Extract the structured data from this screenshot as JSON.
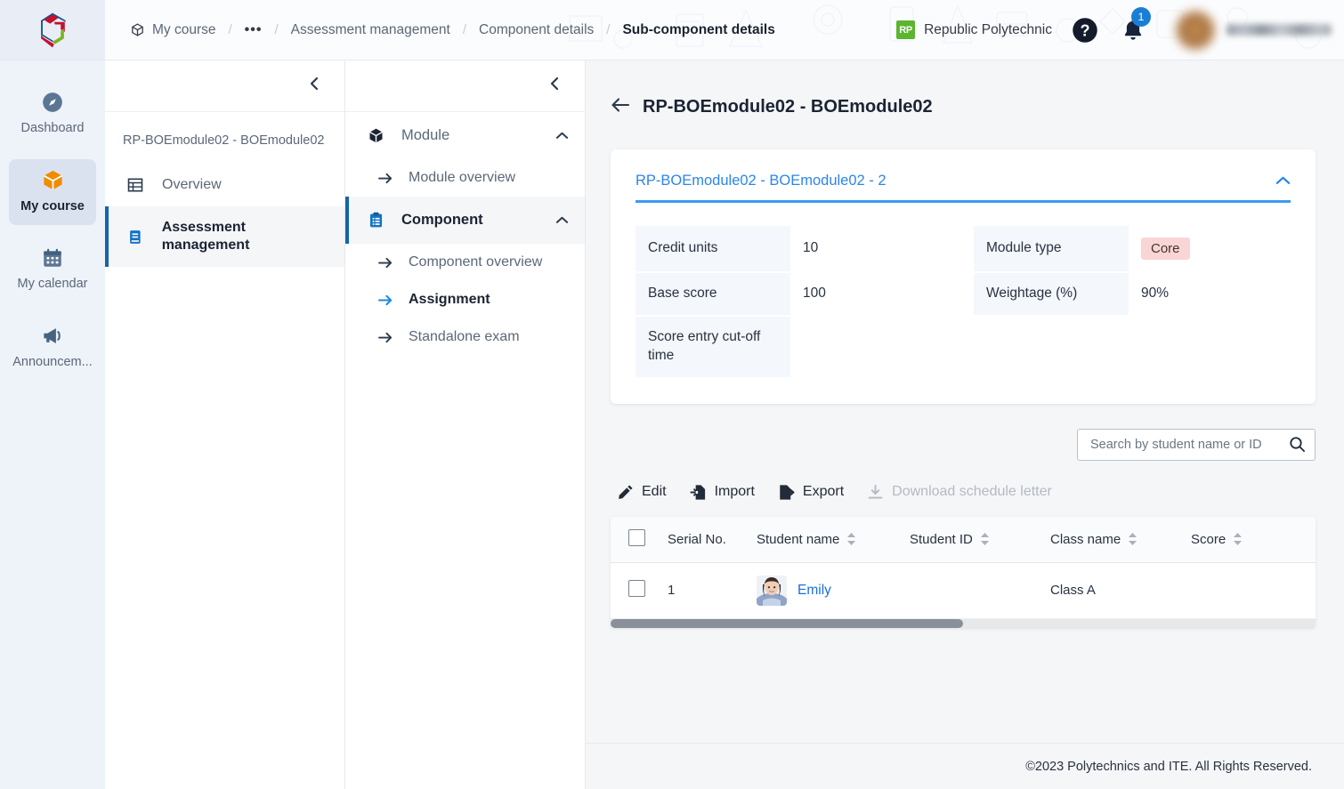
{
  "header": {
    "breadcrumb": [
      {
        "label": "My course",
        "icon": "cube-icon",
        "active": false
      },
      {
        "label": "•••",
        "icon": "ellipsis-icon",
        "active": false
      },
      {
        "label": "Assessment management",
        "icon": "",
        "active": false
      },
      {
        "label": "Component details",
        "icon": "",
        "active": false
      },
      {
        "label": "Sub-component details",
        "icon": "",
        "active": true
      }
    ],
    "institution": {
      "badge": "RP",
      "name": "Republic Polytechnic"
    },
    "help_icon": "help-circle-icon",
    "notification_icon": "bell-icon",
    "notification_count": "1",
    "avatar": "user-avatar",
    "username": ""
  },
  "rail": {
    "items": [
      {
        "label": "Dashboard",
        "icon": "compass-icon",
        "active": false
      },
      {
        "label": "My course",
        "icon": "cube-icon",
        "active": true
      },
      {
        "label": "My calendar",
        "icon": "calendar-icon",
        "active": false
      },
      {
        "label": "Announcem...",
        "icon": "megaphone-icon",
        "active": false
      }
    ]
  },
  "panel1": {
    "collapse_icon": "chevron-left-icon",
    "course_name": "RP-BOEmodule02 - BOEmodule02",
    "items": [
      {
        "label": "Overview",
        "icon": "table-icon",
        "active": false
      },
      {
        "label": "Assessment management",
        "icon": "book-icon",
        "active": true
      }
    ]
  },
  "panel2": {
    "collapse_icon": "chevron-left-icon",
    "groups": [
      {
        "label": "Module",
        "icon": "cube-icon",
        "active": false,
        "expanded": true,
        "chevron": "chevron-up-icon",
        "children": [
          {
            "label": "Module overview",
            "active": false
          }
        ]
      },
      {
        "label": "Component",
        "icon": "clipboard-icon",
        "active": true,
        "expanded": true,
        "chevron": "chevron-up-icon",
        "children": [
          {
            "label": "Component overview",
            "active": false
          },
          {
            "label": "Assignment",
            "active": true
          },
          {
            "label": "Standalone exam",
            "active": false
          }
        ]
      }
    ]
  },
  "main": {
    "back_icon": "arrow-left-icon",
    "page_title": "RP-BOEmodule02 - BOEmodule02",
    "accordion": {
      "title": "RP-BOEmodule02 - BOEmodule02 - 2",
      "chevron": "chevron-up-icon",
      "accent_color": "#3b9bf0",
      "fields": [
        {
          "key": "Credit units",
          "value": "10",
          "type": "text"
        },
        {
          "key": "Module type",
          "value": "Core",
          "type": "pill",
          "pill_bg": "#fad5d5"
        },
        {
          "key": "Base score",
          "value": "100",
          "type": "text"
        },
        {
          "key": "Weightage (%)",
          "value": "90%",
          "type": "text"
        },
        {
          "key": "Score entry cut-off time",
          "value": "",
          "type": "text"
        }
      ]
    },
    "search": {
      "placeholder": "Search by student name or ID",
      "value": "",
      "icon": "search-icon"
    },
    "toolbar": [
      {
        "label": "Edit",
        "icon": "pencil-icon",
        "disabled": false
      },
      {
        "label": "Import",
        "icon": "file-import-icon",
        "disabled": false
      },
      {
        "label": "Export",
        "icon": "file-export-icon",
        "disabled": false
      },
      {
        "label": "Download schedule letter",
        "icon": "download-icon",
        "disabled": true
      }
    ],
    "table": {
      "select_all": false,
      "columns": [
        {
          "label": "Serial No.",
          "sortable": false
        },
        {
          "label": "Student name",
          "sortable": true
        },
        {
          "label": "Student ID",
          "sortable": true
        },
        {
          "label": "Class name",
          "sortable": true
        },
        {
          "label": "Score",
          "sortable": true
        }
      ],
      "rows": [
        {
          "checked": false,
          "serial": "1",
          "student_name": "Emily",
          "student_id": "",
          "class_name": "Class A",
          "score": ""
        }
      ],
      "hscroll_thumb_pct": 50
    }
  },
  "footer": {
    "copyright": "©2023 Polytechnics and ITE. All Rights Reserved."
  }
}
